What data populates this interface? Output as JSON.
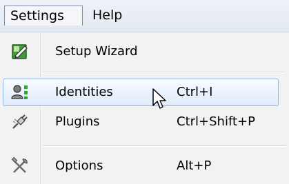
{
  "menubar": {
    "menus": [
      {
        "label": "Settings",
        "active": true
      },
      {
        "label": "Help",
        "active": false
      }
    ]
  },
  "dropdown": {
    "items": [
      {
        "label": "Setup Wizard",
        "shortcut": "",
        "icon": "setup-wizard-icon",
        "highlighted": false
      },
      {
        "label": "Identities",
        "shortcut": "Ctrl+I",
        "icon": "identities-icon",
        "highlighted": true
      },
      {
        "label": "Plugins",
        "shortcut": "Ctrl+Shift+P",
        "icon": "plugins-icon",
        "highlighted": false
      },
      {
        "label": "Options",
        "shortcut": "Alt+P",
        "icon": "options-icon",
        "highlighted": false
      }
    ]
  },
  "colors": {
    "highlight_border": "#8fb5e6",
    "highlight_fill": "#dfecfb",
    "menu_background": "#f2f2f2"
  }
}
